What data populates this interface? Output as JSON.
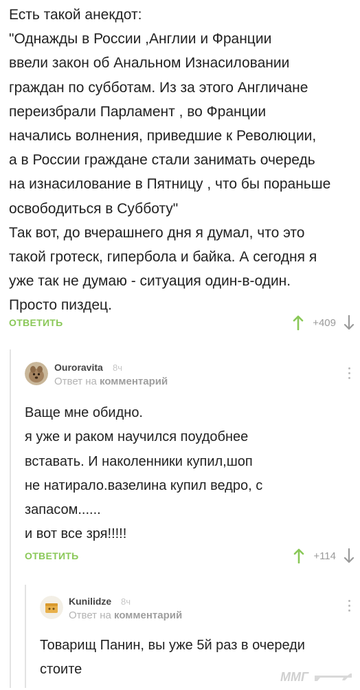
{
  "post": {
    "lines": [
      "Есть такой анекдот:",
      "\"Однажды в России ,Англии и Франции",
      "ввели закон об Анальном Изнасиловании",
      "граждан по субботам. Из за этого Англичане",
      "переизбрали Парламент , во Франции",
      "начались волнения, приведшие к Революции,",
      "а в России граждане стали занимать очередь",
      "на изнасилование в Пятницу , что бы пораньше",
      "освободиться в Субботу\"",
      "Так вот, до вчерашнего дня я думал, что это",
      "такой гротеск, гипербола  и байка. А сегодня я",
      "уже так не думаю - ситуация один-в-один.",
      "Просто пиздец."
    ],
    "reply_label": "ОТВЕТИТЬ",
    "rating": "+409"
  },
  "comments": [
    {
      "author": "Ouroravita",
      "time": "8ч",
      "reply_prefix": "Ответ на",
      "reply_link": "комментарий",
      "lines": [
        "Ваще мне обидно.",
        "я уже и раком научился поудобнее",
        "вставать. И наколенники купил,шоп",
        "не натирало.вазелина купил ведро, с",
        "запасом......",
        "и вот все зря!!!!!"
      ],
      "reply_label": "ОТВЕТИТЬ",
      "rating": "+114"
    },
    {
      "author": "Kunilidze",
      "time": "8ч",
      "reply_prefix": "Ответ на",
      "reply_link": "комментарий",
      "lines": [
        "Товарищ Панин, вы уже 5й раз в очереди",
        "стоите"
      ]
    }
  ],
  "watermark": "ММГ",
  "colors": {
    "accent_green": "#8ac858",
    "muted_text": "#9a9a9a",
    "thread_line": "#e3e3e3"
  },
  "icons": {
    "vote_up": "arrow-up-icon",
    "vote_down": "arrow-down-icon",
    "more": "more-vertical-icon"
  }
}
